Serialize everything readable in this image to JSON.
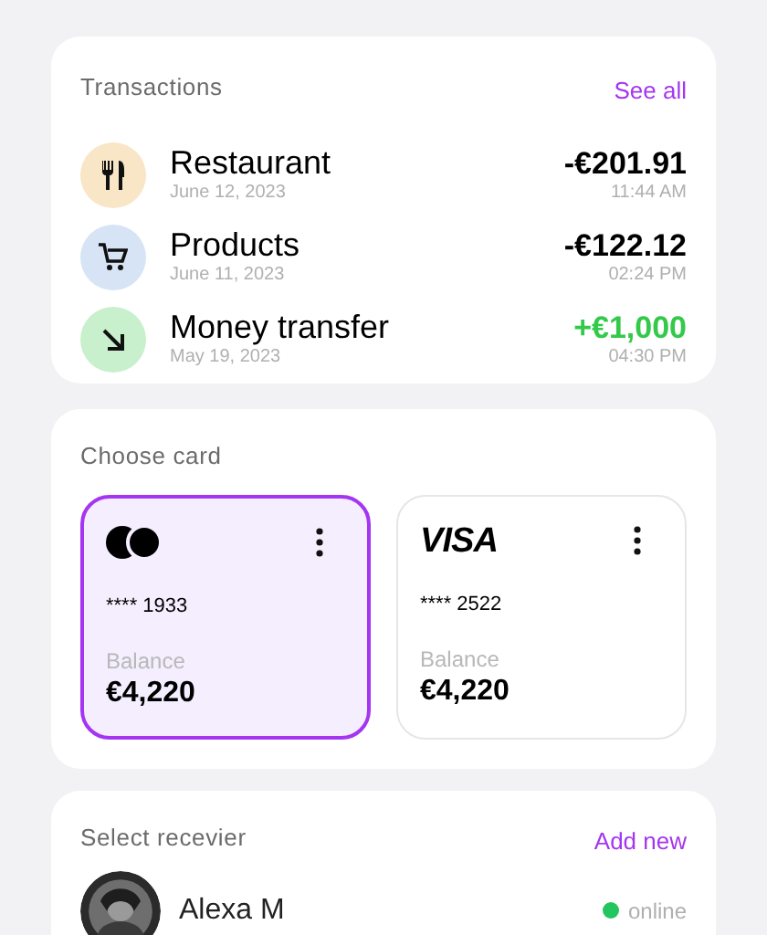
{
  "transactions": {
    "title": "Transactions",
    "action": "See all",
    "items": [
      {
        "kind": "restaurant",
        "name": "Restaurant",
        "date": "June 12, 2023",
        "amount": "-€201.91",
        "time": "11:44 AM",
        "incoming": false,
        "color": "#f8e6c6"
      },
      {
        "kind": "products",
        "name": "Products",
        "date": "June 11, 2023",
        "amount": "-€122.12",
        "time": "02:24 PM",
        "incoming": false,
        "color": "#d6e4f5"
      },
      {
        "kind": "transfer",
        "name": "Money transfer",
        "date": "May 19, 2023",
        "amount": "+€1,000",
        "time": "04:30 PM",
        "incoming": true,
        "color": "#c8f0cc"
      }
    ]
  },
  "cards": {
    "title": "Choose card",
    "items": [
      {
        "kind": "mastercard",
        "number": "**** 1933",
        "balance_label": "Balance",
        "balance": "€4,220",
        "selected": true
      },
      {
        "kind": "visa",
        "brand_text": "VISA",
        "number": "**** 2522",
        "balance_label": "Balance",
        "balance": "€4,220",
        "selected": false
      }
    ]
  },
  "receivers": {
    "title": "Select recevier",
    "action": "Add new",
    "items": [
      {
        "name": "Alexa M",
        "status": "online",
        "color": "#22c55e"
      }
    ]
  }
}
